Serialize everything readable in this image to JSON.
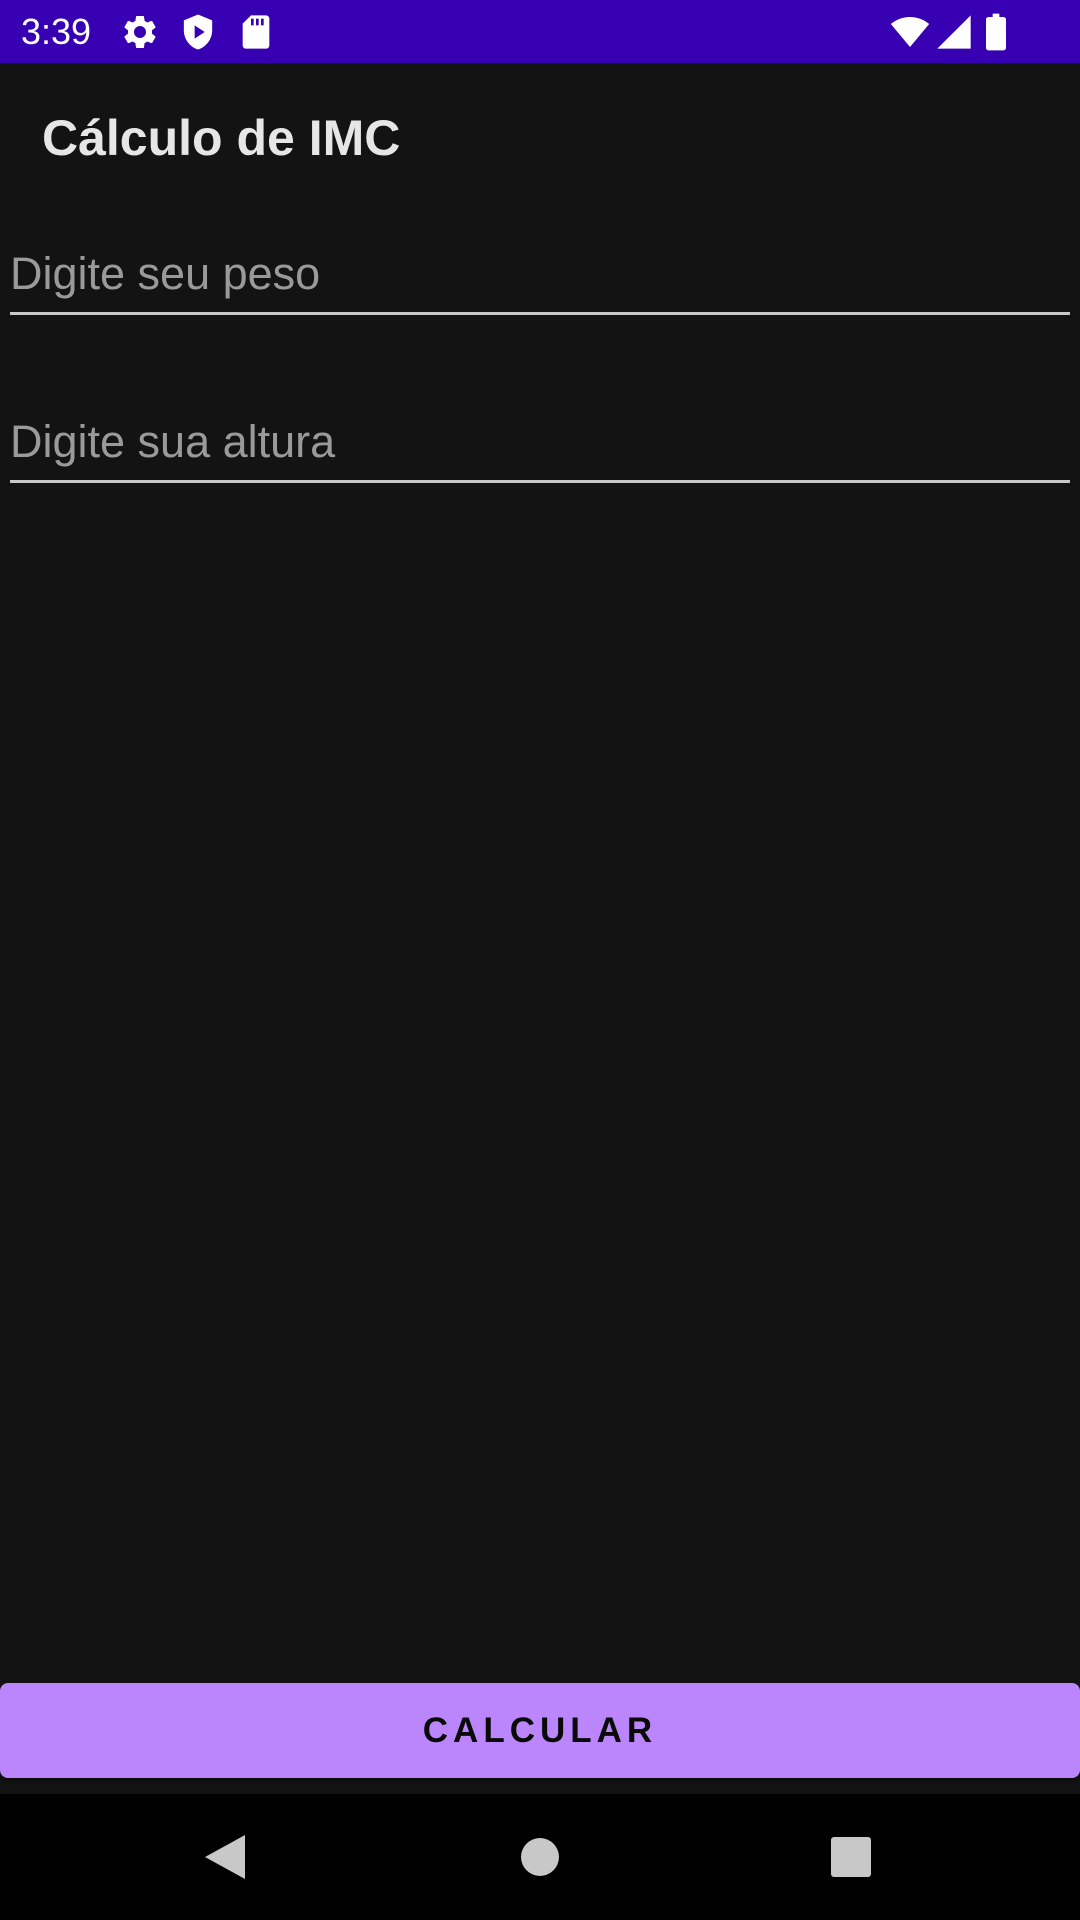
{
  "status_bar": {
    "time": "3:39",
    "background": "#3700b3",
    "left_icons": [
      "gear-icon",
      "shield-play-icon",
      "sd-card-icon"
    ],
    "right_icons": [
      "wifi-icon",
      "cell-signal-icon",
      "battery-icon"
    ]
  },
  "app": {
    "title": "Cálculo de IMC"
  },
  "form": {
    "weight_placeholder": "Digite seu peso",
    "weight_value": "",
    "height_placeholder": "Digite sua altura",
    "height_value": ""
  },
  "actions": {
    "calculate_label": "CALCULAR",
    "accent_color": "#bb86fc"
  },
  "nav_bar": {
    "icons": [
      "back-icon",
      "home-icon",
      "recents-icon"
    ]
  }
}
